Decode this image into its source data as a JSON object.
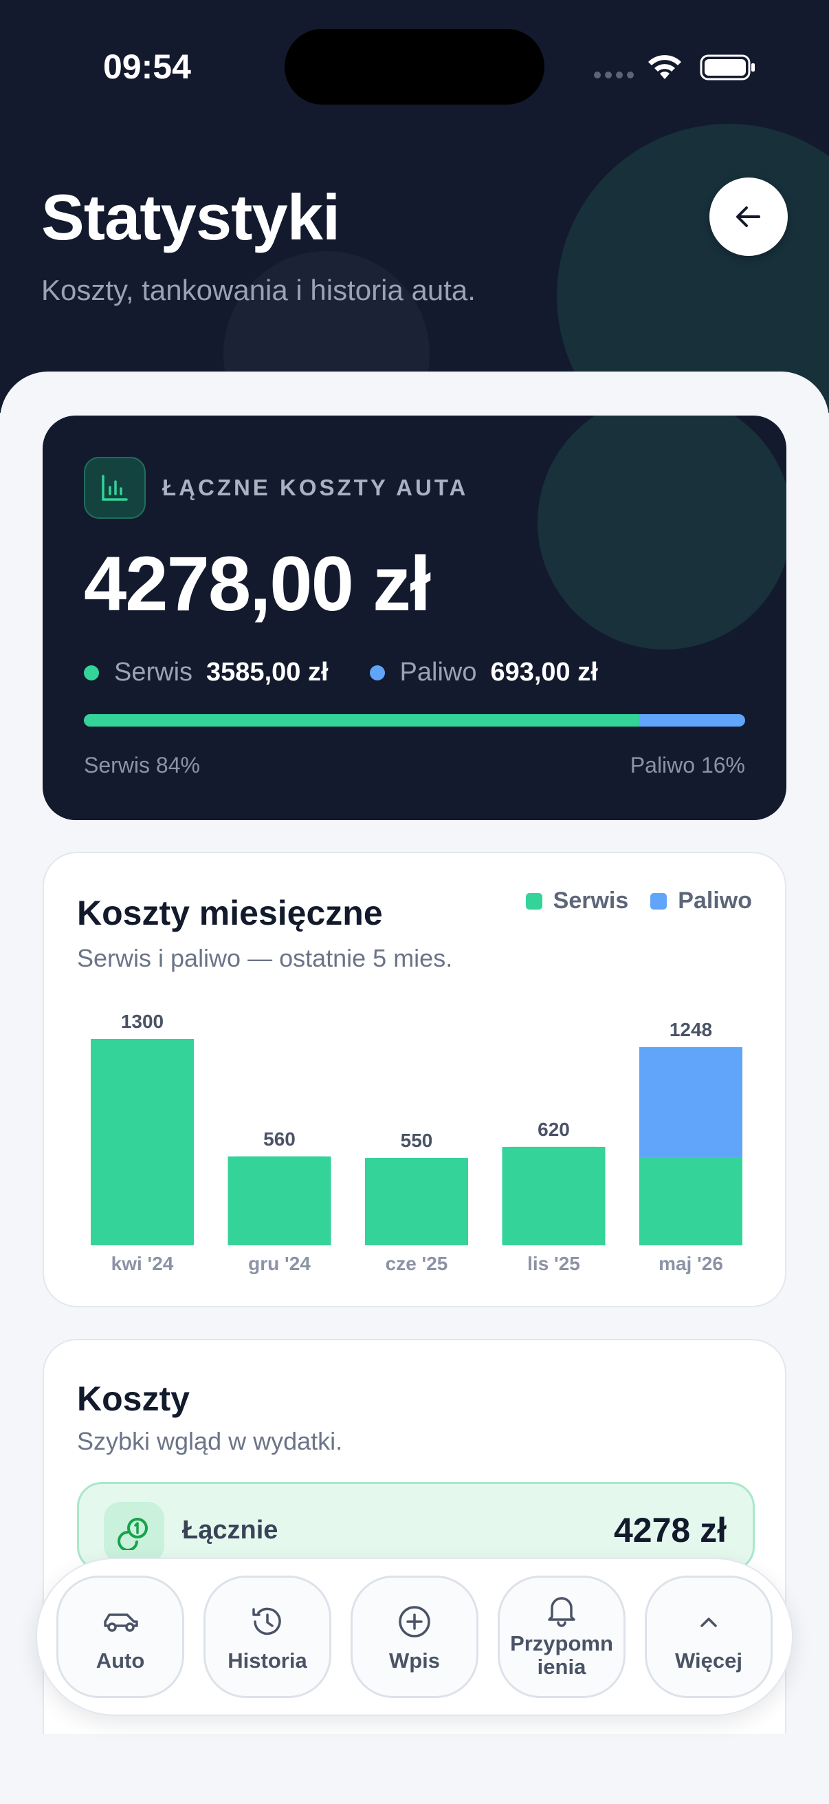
{
  "status_bar": {
    "time": "09:54"
  },
  "header": {
    "title": "Statystyki",
    "subtitle": "Koszty, tankowania i historia auta."
  },
  "summary": {
    "label": "ŁĄCZNE KOSZTY AUTA",
    "total": "4278,00 zł",
    "serwis_label": "Serwis",
    "serwis_value": "3585,00 zł",
    "paliwo_label": "Paliwo",
    "paliwo_value": "693,00 zł",
    "serwis_share": 0.84,
    "serwis_pct_text": "Serwis 84%",
    "paliwo_pct_text": "Paliwo 16%",
    "colors": {
      "serwis": "#34d399",
      "paliwo": "#60a5fa"
    }
  },
  "monthly": {
    "title": "Koszty miesięczne",
    "subtitle": "Serwis i paliwo — ostatnie 5 mies.",
    "legend_serwis": "Serwis",
    "legend_paliwo": "Paliwo"
  },
  "chart_data": {
    "type": "bar",
    "stacked": true,
    "categories": [
      "kwi '24",
      "gru '24",
      "cze '25",
      "lis '25",
      "maj '26"
    ],
    "series": [
      {
        "name": "Serwis",
        "values": [
          1300,
          560,
          550,
          620,
          555
        ],
        "color": "#34d399"
      },
      {
        "name": "Paliwo",
        "values": [
          0,
          0,
          0,
          0,
          693
        ],
        "color": "#60a5fa"
      }
    ],
    "totals": [
      1300,
      560,
      550,
      620,
      1248
    ],
    "legend": "top-right",
    "grid": false
  },
  "costs": {
    "title": "Koszty",
    "subtitle": "Szybki wgląd w wydatki.",
    "total_label": "Łącznie",
    "total_value": "4278 zł"
  },
  "nav": {
    "items": [
      {
        "label": "Auto",
        "icon": "car-icon"
      },
      {
        "label": "Historia",
        "icon": "history-icon"
      },
      {
        "label": "Wpis",
        "icon": "plus-circle-icon"
      },
      {
        "label": "Przypomnienia",
        "icon": "bell-icon"
      },
      {
        "label": "Więcej",
        "icon": "chevron-up-icon"
      }
    ]
  }
}
